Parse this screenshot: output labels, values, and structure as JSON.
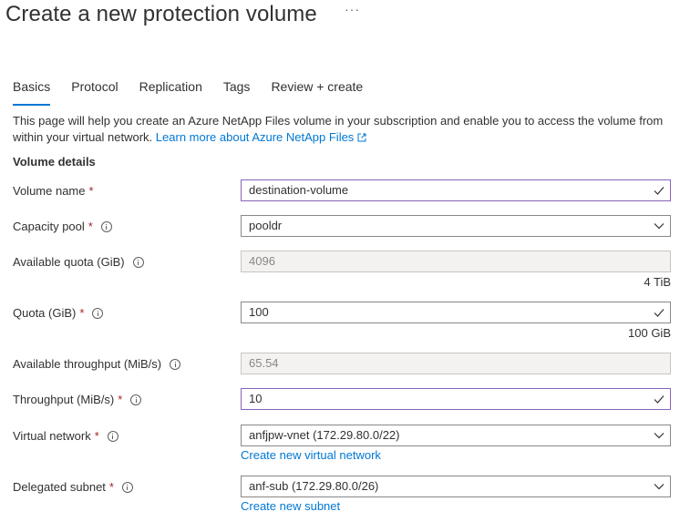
{
  "header": {
    "title": "Create a new protection volume",
    "more_label": "···"
  },
  "tabs": [
    {
      "label": "Basics",
      "active": true
    },
    {
      "label": "Protocol"
    },
    {
      "label": "Replication"
    },
    {
      "label": "Tags"
    },
    {
      "label": "Review + create"
    }
  ],
  "intro": {
    "text": "This page will help you create an Azure NetApp Files volume in your subscription and enable you to access the volume from within your virtual network.",
    "link": "Learn more about Azure NetApp Files"
  },
  "section_title": "Volume details",
  "fields": {
    "volume_name": {
      "label": "Volume name",
      "value": "destination-volume"
    },
    "capacity_pool": {
      "label": "Capacity pool",
      "value": "pooldr"
    },
    "available_quota": {
      "label": "Available quota (GiB)",
      "value": "4096",
      "hint": "4 TiB"
    },
    "quota": {
      "label": "Quota (GiB)",
      "value": "100",
      "hint": "100 GiB"
    },
    "available_throughput": {
      "label": "Available throughput (MiB/s)",
      "value": "65.54"
    },
    "throughput": {
      "label": "Throughput (MiB/s)",
      "value": "10"
    },
    "virtual_network": {
      "label": "Virtual network",
      "value": "anfjpw-vnet (172.29.80.0/22)",
      "link": "Create new virtual network"
    },
    "delegated_subnet": {
      "label": "Delegated subnet",
      "value": "anf-sub (172.29.80.0/26)",
      "link": "Create new subnet"
    }
  },
  "required_marker": "*",
  "colors": {
    "accent": "#0078d4",
    "focus_border": "#8764b8",
    "required": "#a4262c"
  }
}
